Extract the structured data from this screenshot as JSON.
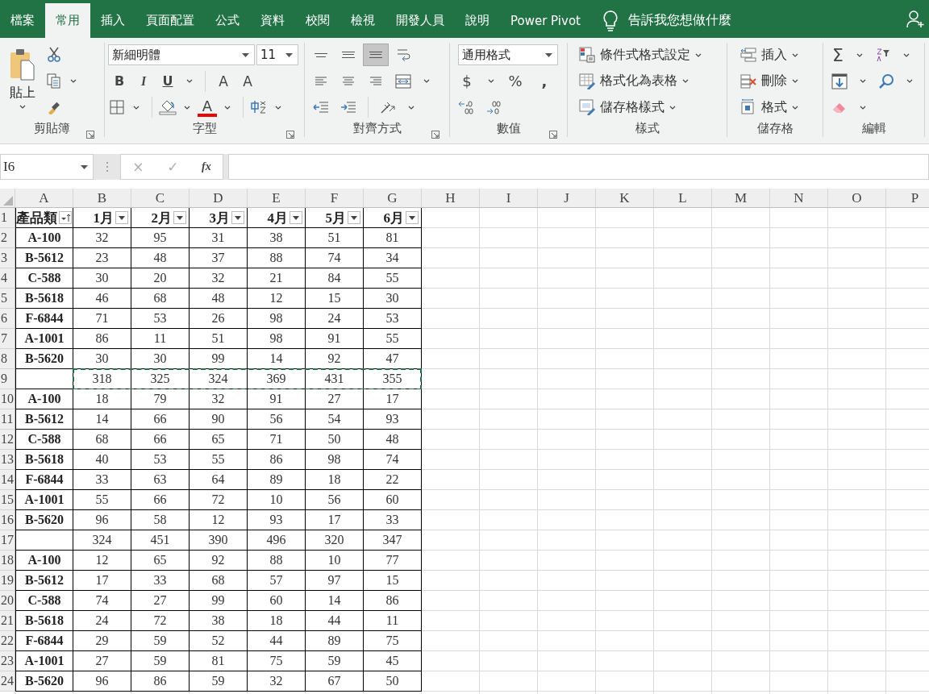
{
  "tabs": [
    {
      "label": "檔案",
      "selected": false
    },
    {
      "label": "常用",
      "selected": true
    },
    {
      "label": "插入",
      "selected": false
    },
    {
      "label": "頁面配置",
      "selected": false
    },
    {
      "label": "公式",
      "selected": false
    },
    {
      "label": "資料",
      "selected": false
    },
    {
      "label": "校閱",
      "selected": false
    },
    {
      "label": "檢視",
      "selected": false
    },
    {
      "label": "開發人員",
      "selected": false
    },
    {
      "label": "說明",
      "selected": false
    },
    {
      "label": "Power Pivot",
      "selected": false
    }
  ],
  "tell_me": "告訴我您想做什麼",
  "ribbon": {
    "clipboard": {
      "paste": "貼上",
      "label": "剪貼簿"
    },
    "font": {
      "name": "新細明體",
      "size": "11",
      "bold": "B",
      "italic": "I",
      "underline": "U",
      "grow": "A",
      "shrink": "A",
      "font_color_letter": "A",
      "label": "字型"
    },
    "alignment": {
      "vertical": [
        {
          "selected": false
        },
        {
          "selected": false
        },
        {
          "selected": true
        }
      ],
      "label": "對齊方式"
    },
    "number": {
      "format": "通用格式",
      "currency": "$",
      "percent": "%",
      "comma": ",",
      "label": "數值"
    },
    "styles": {
      "items": [
        "條件式格式設定",
        "格式化為表格",
        "儲存格樣式"
      ],
      "label": "樣式"
    },
    "cells": {
      "items": [
        "插入",
        "刪除",
        "格式"
      ],
      "label": "儲存格"
    },
    "editing": {
      "sum": "Σ",
      "label": "編輯"
    }
  },
  "formula_bar": {
    "name_box": "I6",
    "cancel": "×",
    "enter": "✓",
    "function": "fx"
  },
  "columns": [
    "A",
    "B",
    "C",
    "D",
    "E",
    "F",
    "G",
    "H",
    "I",
    "J",
    "K",
    "L",
    "M",
    "N",
    "O",
    "P"
  ],
  "header": {
    "num": "1",
    "cells": [
      {
        "text": "產品類",
        "sorted": true
      },
      {
        "text": "1月",
        "sorted": false
      },
      {
        "text": "2月",
        "sorted": false
      },
      {
        "text": "3月",
        "sorted": false
      },
      {
        "text": "4月",
        "sorted": false
      },
      {
        "text": "5月",
        "sorted": false
      },
      {
        "text": "6月",
        "sorted": false
      }
    ]
  },
  "rows": [
    {
      "num": "2",
      "label": "A-100",
      "values": [
        "32",
        "95",
        "31",
        "38",
        "51",
        "81"
      ],
      "marquee": false
    },
    {
      "num": "3",
      "label": "B-5612",
      "values": [
        "23",
        "48",
        "37",
        "88",
        "74",
        "34"
      ],
      "marquee": false
    },
    {
      "num": "4",
      "label": "C-588",
      "values": [
        "30",
        "20",
        "32",
        "21",
        "84",
        "55"
      ],
      "marquee": false
    },
    {
      "num": "5",
      "label": "B-5618",
      "values": [
        "46",
        "68",
        "48",
        "12",
        "15",
        "30"
      ],
      "marquee": false
    },
    {
      "num": "6",
      "label": "F-6844",
      "values": [
        "71",
        "53",
        "26",
        "98",
        "24",
        "53"
      ],
      "marquee": false
    },
    {
      "num": "7",
      "label": "A-1001",
      "values": [
        "86",
        "11",
        "51",
        "98",
        "91",
        "55"
      ],
      "marquee": false
    },
    {
      "num": "8",
      "label": "B-5620",
      "values": [
        "30",
        "30",
        "99",
        "14",
        "92",
        "47"
      ],
      "marquee": false
    },
    {
      "num": "9",
      "values": [
        "318",
        "325",
        "324",
        "369",
        "431",
        "355"
      ],
      "marquee": true
    },
    {
      "num": "10",
      "label": "A-100",
      "values": [
        "18",
        "79",
        "32",
        "91",
        "27",
        "17"
      ],
      "marquee": false
    },
    {
      "num": "11",
      "label": "B-5612",
      "values": [
        "14",
        "66",
        "90",
        "56",
        "54",
        "93"
      ],
      "marquee": false
    },
    {
      "num": "12",
      "label": "C-588",
      "values": [
        "68",
        "66",
        "65",
        "71",
        "50",
        "48"
      ],
      "marquee": false
    },
    {
      "num": "13",
      "label": "B-5618",
      "values": [
        "40",
        "53",
        "55",
        "86",
        "98",
        "74"
      ],
      "marquee": false
    },
    {
      "num": "14",
      "label": "F-6844",
      "values": [
        "33",
        "63",
        "64",
        "89",
        "18",
        "22"
      ],
      "marquee": false
    },
    {
      "num": "15",
      "label": "A-1001",
      "values": [
        "55",
        "66",
        "72",
        "10",
        "56",
        "60"
      ],
      "marquee": false
    },
    {
      "num": "16",
      "label": "B-5620",
      "values": [
        "96",
        "58",
        "12",
        "93",
        "17",
        "33"
      ],
      "marquee": false
    },
    {
      "num": "17",
      "values": [
        "324",
        "451",
        "390",
        "496",
        "320",
        "347"
      ],
      "marquee": false
    },
    {
      "num": "18",
      "label": "A-100",
      "values": [
        "12",
        "65",
        "92",
        "88",
        "10",
        "77"
      ],
      "marquee": false
    },
    {
      "num": "19",
      "label": "B-5612",
      "values": [
        "17",
        "33",
        "68",
        "57",
        "97",
        "15"
      ],
      "marquee": false
    },
    {
      "num": "20",
      "label": "C-588",
      "values": [
        "74",
        "27",
        "99",
        "60",
        "14",
        "86"
      ],
      "marquee": false
    },
    {
      "num": "21",
      "label": "B-5618",
      "values": [
        "24",
        "72",
        "38",
        "18",
        "44",
        "11"
      ],
      "marquee": false
    },
    {
      "num": "22",
      "label": "F-6844",
      "values": [
        "29",
        "59",
        "52",
        "44",
        "89",
        "75"
      ],
      "marquee": false
    },
    {
      "num": "23",
      "label": "A-1001",
      "values": [
        "27",
        "59",
        "81",
        "75",
        "59",
        "45"
      ],
      "marquee": false
    },
    {
      "num": "24",
      "label": "B-5620",
      "values": [
        "96",
        "86",
        "59",
        "32",
        "67",
        "50"
      ],
      "marquee": false
    }
  ]
}
